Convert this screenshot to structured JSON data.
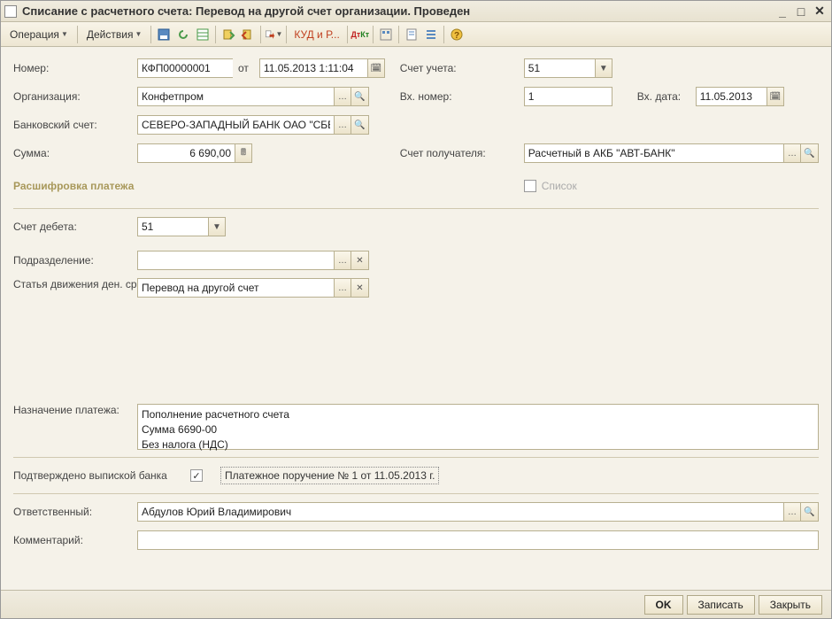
{
  "window": {
    "title": "Списание с расчетного счета: Перевод на другой счет организации. Проведен"
  },
  "toolbar": {
    "operation": "Операция",
    "actions": "Действия",
    "kud": "КУД и Р..."
  },
  "labels": {
    "number": "Номер:",
    "from": "от",
    "org": "Организация:",
    "bank_account": "Банковский счет:",
    "sum": "Сумма:",
    "account_uchet": "Счет учета:",
    "in_number": "Вх. номер:",
    "in_date": "Вх. дата:",
    "recipient_account": "Счет получателя:",
    "decrypt": "Расшифровка платежа",
    "list": "Список",
    "debit": "Счет дебета:",
    "division": "Подразделение:",
    "article": "Статья движения ден. средств:",
    "purpose": "Назначение платежа:",
    "confirmed": "Подтверждено выпиской банка",
    "responsible": "Ответственный:",
    "comment": "Комментарий:"
  },
  "fields": {
    "number": "КФП00000001",
    "datetime": "11.05.2013 1:11:04",
    "org": "Конфетпром",
    "bank_account": "СЕВЕРО-ЗАПАДНЫЙ БАНК ОАО \"СБЕ...",
    "sum": "6 690,00",
    "account_uchet": "51",
    "in_number": "1",
    "in_date": "11.05.2013",
    "recipient_account": "Расчетный в АКБ \"АВТ-БАНК\"",
    "debit": "51",
    "division": "",
    "article": "Перевод на другой счет",
    "purpose": "Пополнение расчетного счета\nСумма 6690-00\nБез налога (НДС)",
    "confirmed": true,
    "payment_order_link": "Платежное поручение № 1 от 11.05.2013 г.",
    "responsible": "Абдулов Юрий Владимирович",
    "comment": ""
  },
  "footer": {
    "ok": "OK",
    "write": "Записать",
    "close": "Закрыть"
  }
}
